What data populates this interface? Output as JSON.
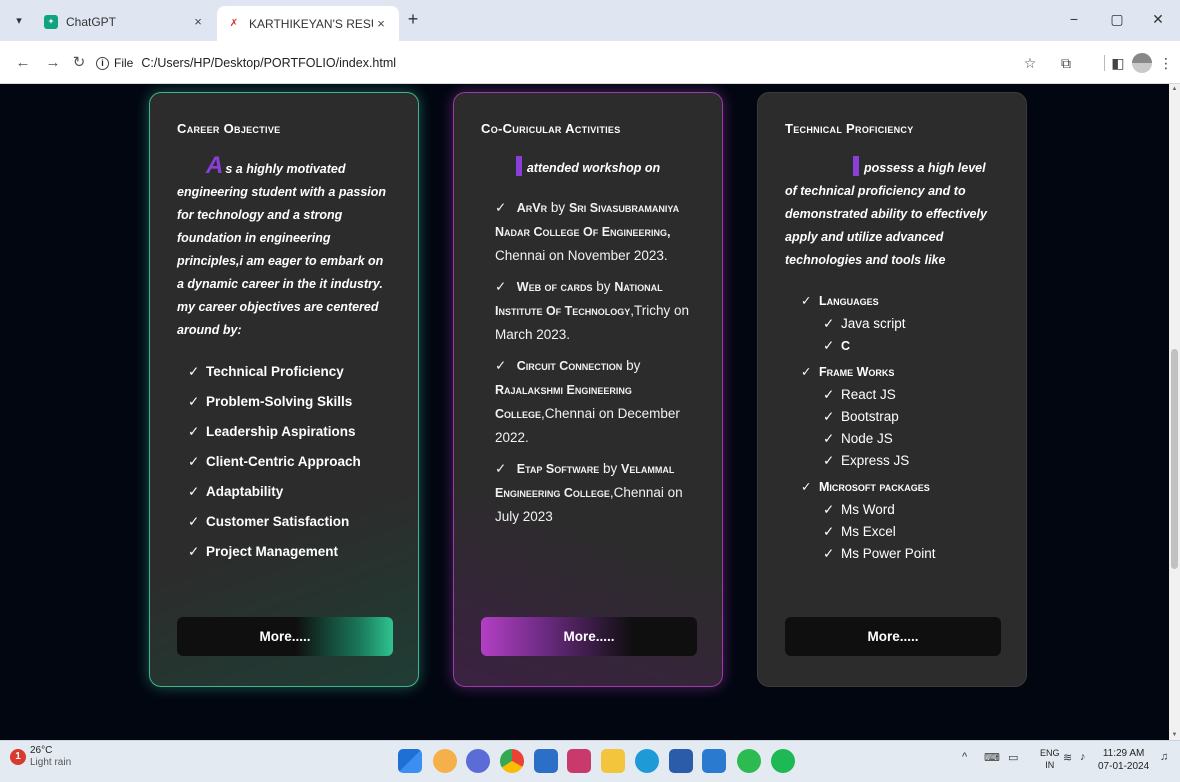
{
  "browser": {
    "tabs": [
      {
        "label": "ChatGPT",
        "close": "×"
      },
      {
        "label": "KARTHIKEYAN'S RESUME",
        "close": "×"
      }
    ],
    "new_tab": "+",
    "win_min": "−",
    "win_max": "▢",
    "win_close": "✕",
    "address": {
      "scheme_label": "File",
      "url": "C:/Users/HP/Desktop/PORTFOLIO/index.html"
    }
  },
  "cards": {
    "career": {
      "title": "Career Objective",
      "dropcap": "A",
      "intro": "s a highly motivated engineering student with a passion for technology and a strong foundation in engineering principles,i am eager to embark on a dynamic career in the it industry. my career objectives are centered around by:",
      "items": [
        "Technical Proficiency",
        "Problem-Solving Skills",
        "Leadership Aspirations",
        "Client-Centric Approach",
        "Adaptability",
        "Customer Satisfaction",
        "Project Management"
      ],
      "more": "More....."
    },
    "cocurricular": {
      "title": "Co-Curicular Activities",
      "intro": "attended workshop on",
      "activities": [
        {
          "event": "ArVr",
          "by": "by",
          "org": "Sri Sivasubramaniya Nadar College Of Engineering,",
          "rest": "Chennai on November 2023."
        },
        {
          "event": "Web of cards",
          "by": "by",
          "org": "National Institute Of Technology",
          "rest": ",Trichy on March 2023."
        },
        {
          "event": "Circuit Connection",
          "by": "by",
          "org": "Rajalakshmi Engineering College",
          "rest": ",Chennai on December 2022."
        },
        {
          "event": "Etap Software",
          "by": "by",
          "org": "Velammal Engineering College",
          "rest": ",Chennai on July 2023"
        }
      ],
      "more": "More....."
    },
    "technical": {
      "title": "Technical Proficiency",
      "intro": "possess a high level of technical proficiency and to demonstrated ability to effectively apply and utilize advanced technologies and tools like",
      "groups": [
        {
          "title": "Languages",
          "items": [
            "Java script",
            "C"
          ]
        },
        {
          "title": "Frame Works",
          "items": [
            "React JS",
            "Bootstrap",
            "Node JS",
            "Express JS"
          ]
        },
        {
          "title": "Microsoft packages",
          "items": [
            "Ms Word",
            "Ms Excel",
            "Ms Power Point"
          ]
        }
      ],
      "more": "More....."
    }
  },
  "check": "✓",
  "taskbar": {
    "weather_temp": "26°C",
    "weather_desc": "Light rain",
    "weather_badge": "1",
    "lang_1": "ENG",
    "lang_2": "IN",
    "time": "11:29 AM",
    "date": "07-01-2024"
  },
  "colors": {
    "page_bg": "#020611",
    "card_bg": "#2c2c2c",
    "accent_purple": "#8a3fd8",
    "accent_green": "#2fc490"
  }
}
